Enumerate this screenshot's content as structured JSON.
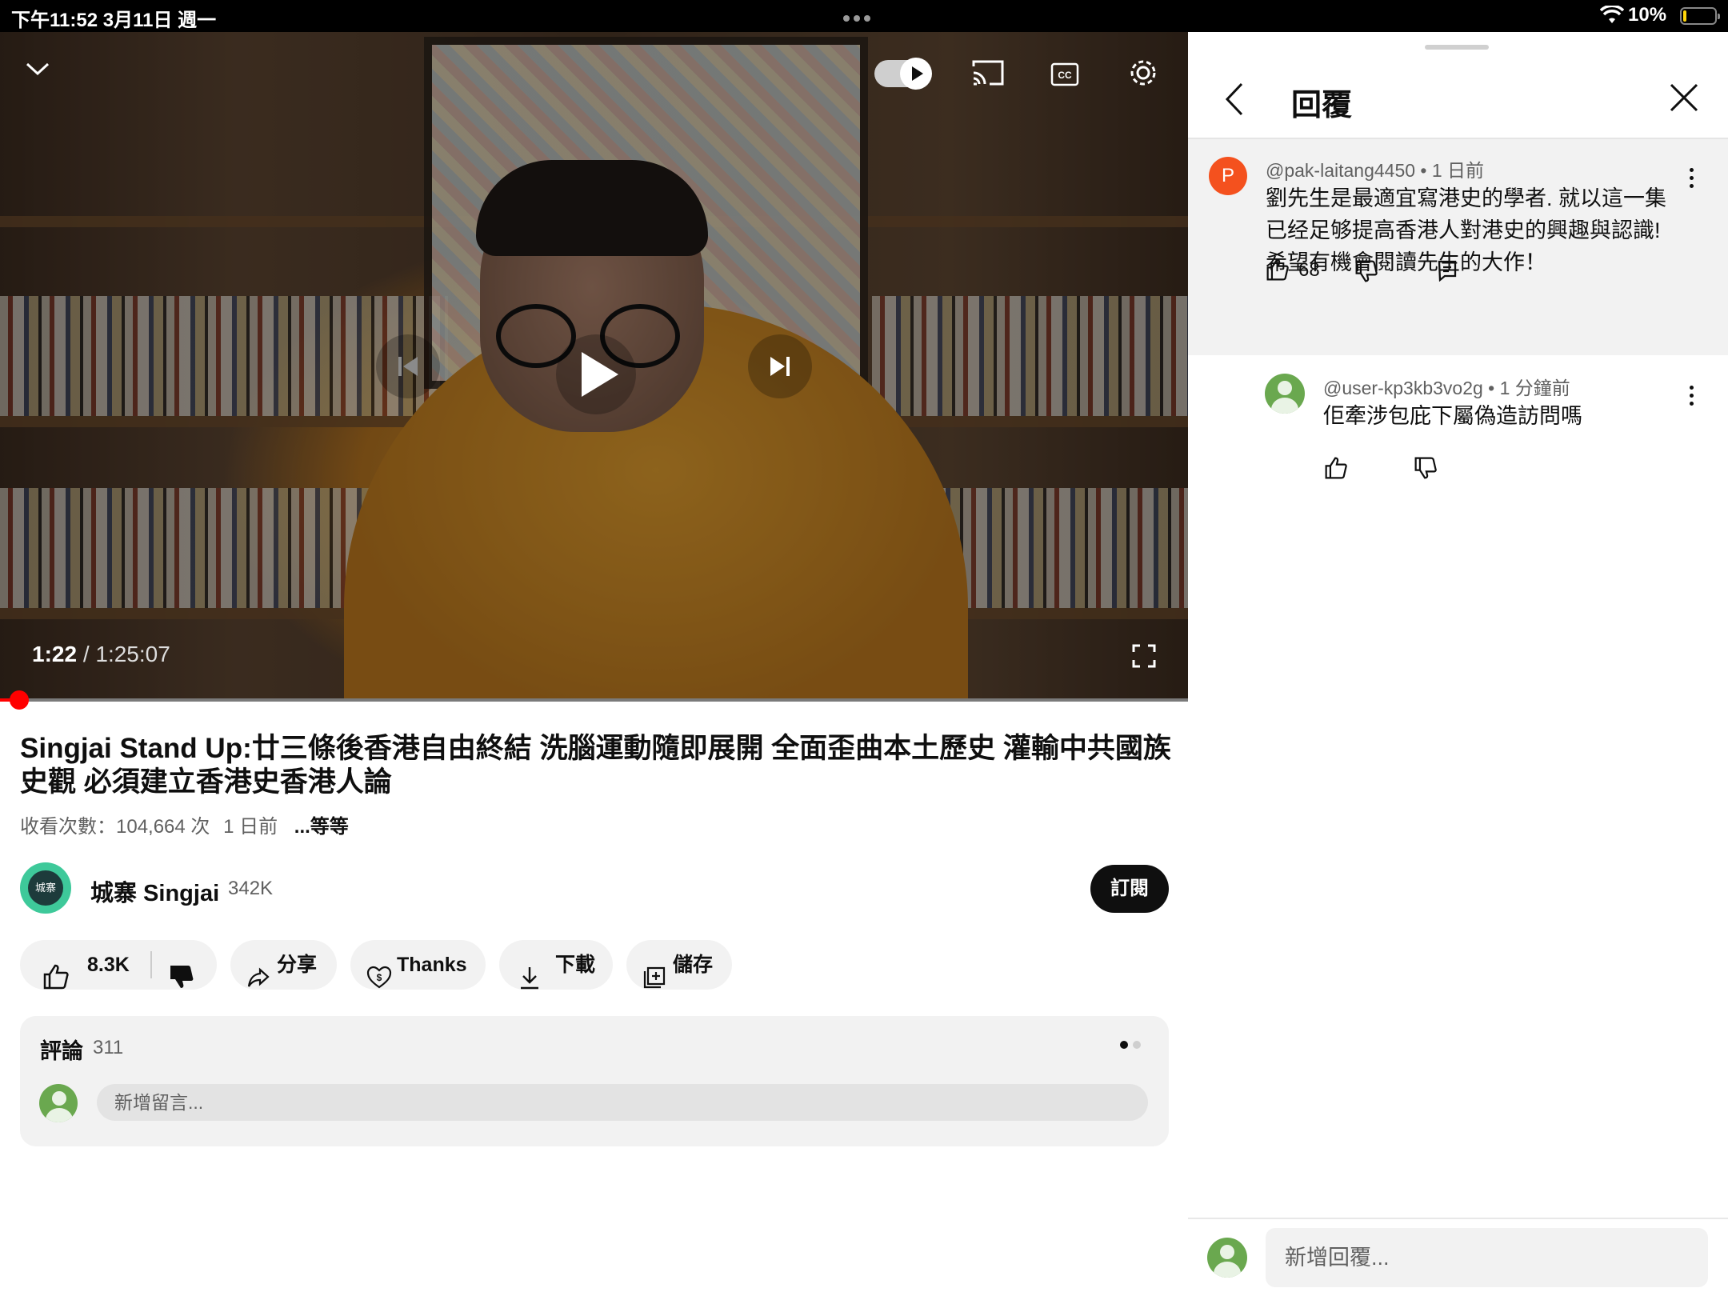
{
  "status_bar": {
    "time": "下午11:52 3月11日 週一",
    "battery_pct": "10%",
    "battery_color": "#ffd60a"
  },
  "player": {
    "current_time": "1:22",
    "duration": "/ 1:25:07",
    "progress_fraction": 0.016,
    "autoplay_on": true,
    "cc_label": "CC",
    "progress_color": "#ff0000"
  },
  "video": {
    "title": "Singjai Stand Up:廿三條後香港自由終結 洗腦運動隨即展開 全面歪曲本土歷史 灌輸中共國族史觀 必須建立香港史香港人論",
    "views": "收看次數：104,664 次",
    "age": "1 日前",
    "more": "...等等"
  },
  "channel": {
    "avatar_text": "城寨",
    "name": "城寨 Singjai",
    "subscribers": "342K",
    "subscribe_label": "訂閱",
    "accent_color": "#3ec99a"
  },
  "actions": {
    "likes": "8.3K",
    "share": "分享",
    "thanks": "Thanks",
    "download": "下載",
    "save": "儲存"
  },
  "comments": {
    "title": "評論",
    "count": "311",
    "placeholder": "新增留言..."
  },
  "reply_panel": {
    "title": "回覆",
    "parent": {
      "avatar_letter": "P",
      "author": "@pak-laitang4450 • 1 日前",
      "text": "劉先生是最適宜寫港史的學者. 就以這一集已经足够提高香港人對港史的興趣與認識!希望有機會閱讀先生的大作！",
      "likes": "68",
      "avatar_color": "#f4511e"
    },
    "reply": {
      "author": "@user-kp3kb3vo2g • 1 分鐘前",
      "text": "佢牽涉包庇下屬偽造訪問嗎",
      "avatar_color": "#6aa84f"
    },
    "input_placeholder": "新增回覆..."
  }
}
